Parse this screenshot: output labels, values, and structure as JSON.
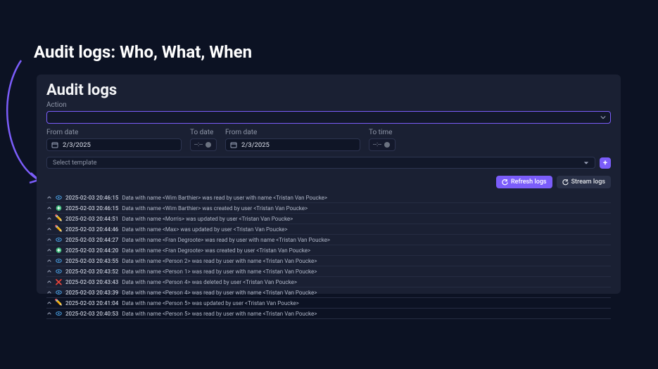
{
  "slide": {
    "title": "Audit logs: Who, What, When"
  },
  "panel": {
    "title": "Audit logs"
  },
  "filters": {
    "action_label": "Action",
    "from_date_label": "From date",
    "to_date_label": "To date",
    "from_date2_label": "From date",
    "to_time_label": "To time",
    "from_date_value": "2/3/2025",
    "from_date2_value": "2/3/2025",
    "time_placeholder": "--:--",
    "template_placeholder": "Select template"
  },
  "buttons": {
    "refresh": "Refresh logs",
    "stream": "Stream logs"
  },
  "icons": {
    "eye_color": "#4aa3e8",
    "plus_color": "#3fb97a",
    "pencil": "✏️",
    "x": "❌"
  },
  "logs": [
    {
      "type": "read",
      "ts": "2025-02-03 20:46:15",
      "msg": "Data with name <Wim Barthier> was read by user with name <Tristan Van Poucke>"
    },
    {
      "type": "created",
      "ts": "2025-02-03 20:46:15",
      "msg": "Data with name <Wim Barthier> was created by user <Tristan Van Poucke>"
    },
    {
      "type": "updated",
      "ts": "2025-02-03 20:44:51",
      "msg": "Data with name <Morris> was updated by user <Tristan Van Poucke>"
    },
    {
      "type": "updated",
      "ts": "2025-02-03 20:44:46",
      "msg": "Data with name <Max> was updated by user <Tristan Van Poucke>"
    },
    {
      "type": "read",
      "ts": "2025-02-03 20:44:27",
      "msg": "Data with name <Fran Degroote> was read by user with name <Tristan Van Poucke>"
    },
    {
      "type": "created",
      "ts": "2025-02-03 20:44:20",
      "msg": "Data with name <Fran Degroote> was created by user <Tristan Van Poucke>"
    },
    {
      "type": "read",
      "ts": "2025-02-03 20:43:55",
      "msg": "Data with name <Person 2> was read by user with name <Tristan Van Poucke>"
    },
    {
      "type": "read",
      "ts": "2025-02-03 20:43:52",
      "msg": "Data with name <Person 1> was read by user with name <Tristan Van Poucke>"
    },
    {
      "type": "deleted",
      "ts": "2025-02-03 20:43:43",
      "msg": "Data with name <Person 4> was deleted by user <Tristan Van Poucke>"
    },
    {
      "type": "read",
      "ts": "2025-02-03 20:43:39",
      "msg": "Data with name <Person 4> was read by user with name <Tristan Van Poucke>"
    },
    {
      "type": "updated",
      "ts": "2025-02-03 20:41:04",
      "msg": "Data with name <Person 5> was updated by user <Tristan Van Poucke>"
    },
    {
      "type": "read",
      "ts": "2025-02-03 20:40:53",
      "msg": "Data with name <Person 5> was read by user with name <Tristan Van Poucke>"
    }
  ]
}
